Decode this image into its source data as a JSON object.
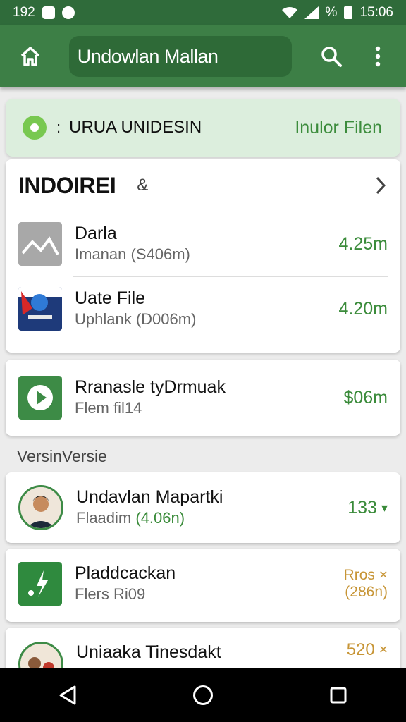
{
  "status_bar": {
    "time": "192",
    "right_time": "15:06",
    "percent": "%"
  },
  "app_bar": {
    "title": "Undowlan Mallan"
  },
  "banner": {
    "marker": ":",
    "title": "URUA UNIDESIN",
    "action": "Inulor Filen"
  },
  "section1": {
    "title": "INDOIREI",
    "mark": "&"
  },
  "items": [
    {
      "title": "Darla",
      "subtitle": "Imanan (S406m)",
      "value": "4.25m"
    },
    {
      "title": "Uate File",
      "subtitle": "Uphlank (D006m)",
      "value": "4.20m"
    }
  ],
  "card2": {
    "title": "Rranasle tyDrmuak",
    "subtitle": "Flem fil14",
    "value": "$06m"
  },
  "section2": {
    "label": "VersinVersie"
  },
  "list2": [
    {
      "title": "Undavlan Mapartki",
      "subtitle_prefix": "Flaadim",
      "subtitle_green": "(4.06n)",
      "value": "133",
      "value_mark": "▾"
    },
    {
      "title": "Pladdcackan",
      "subtitle": "Flers Ri09",
      "value_line1": "Rros",
      "value_mark": "×",
      "value_line2": "(286n)"
    },
    {
      "title": "Uniaaka Tinesdakt",
      "value": "520",
      "value_mark": "×"
    }
  ],
  "colors": {
    "appbar": "#3d7f46",
    "statusbar": "#2f6b3a",
    "accent_green": "#3a8b3a",
    "amber": "#c79536",
    "banner_bg": "#dceedd"
  }
}
